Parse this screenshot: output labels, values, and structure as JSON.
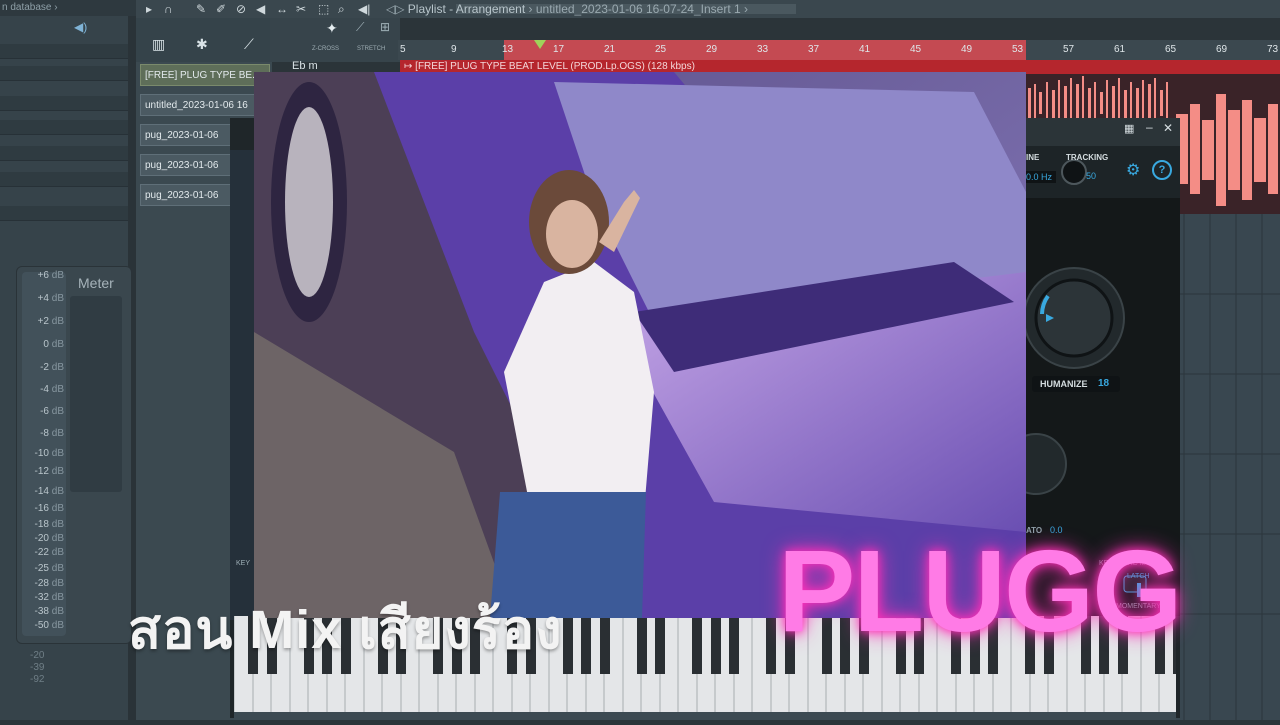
{
  "left_panel": {
    "breadcrumb": "n database",
    "meter": {
      "title": "Meter",
      "scale": [
        {
          "value": "+6",
          "unit": "dB"
        },
        {
          "value": "+4",
          "unit": "dB"
        },
        {
          "value": "+2",
          "unit": "dB"
        },
        {
          "value": "0",
          "unit": "dB"
        },
        {
          "value": "-2",
          "unit": "dB"
        },
        {
          "value": "-4",
          "unit": "dB"
        },
        {
          "value": "-6",
          "unit": "dB"
        },
        {
          "value": "-8",
          "unit": "dB"
        },
        {
          "value": "-10",
          "unit": "dB"
        },
        {
          "value": "-12",
          "unit": "dB"
        },
        {
          "value": "-14",
          "unit": "dB"
        },
        {
          "value": "-16",
          "unit": "dB"
        },
        {
          "value": "-18",
          "unit": "dB"
        },
        {
          "value": "-20",
          "unit": "dB"
        },
        {
          "value": "-22",
          "unit": "dB"
        },
        {
          "value": "-25",
          "unit": "dB"
        },
        {
          "value": "-28",
          "unit": "dB"
        },
        {
          "value": "-32",
          "unit": "dB"
        },
        {
          "value": "-38",
          "unit": "dB"
        },
        {
          "value": "-50",
          "unit": "dB"
        }
      ],
      "lower_scale": [
        "-20",
        "-39",
        "-92"
      ]
    }
  },
  "toolbar": {
    "playlist_title": "Playlist - Arrangement",
    "project_path": "untitled_2023-01-06 16-07-24_Insert 1"
  },
  "tool_strip": {
    "zcross_label": "Z-CROSS",
    "stretch_label": "STRETCH"
  },
  "ruler": {
    "bars": [
      "5",
      "9",
      "13",
      "17",
      "21",
      "25",
      "29",
      "33",
      "37",
      "41",
      "45",
      "49",
      "53",
      "57",
      "61",
      "65",
      "69",
      "73"
    ]
  },
  "tracks": [
    "[FREE] PLUG TYPE BE...",
    "untitled_2023-01-06 16",
    "pug_2023-01-06",
    "pug_2023-01-06",
    "pug_2023-01-06"
  ],
  "key_label": "Eb m",
  "clip_header": "[FREE] PLUG TYPE BEAT  LEVEL  (PROD.Lp.OGS) (128 kbps)",
  "plugin": {
    "line_label": "INE",
    "line_value": "0.0 Hz",
    "tracking_label": "TRACKING",
    "tracking_value": "50",
    "humanize_label": "HUMANIZE",
    "humanize_value": "18",
    "vibrato_label": "ATO",
    "vibrato_value": "0.0",
    "keyboard_mode_label": "KEYBOARD MODE",
    "latch_label": "LATCH",
    "momentary_label": "MOMENTARY",
    "left_label": "KEY"
  },
  "overlay": {
    "thai_title": "สอน Mix เสียงร้อง",
    "plugg": "PLUGG"
  },
  "colors": {
    "accent_pink": "#ff7be6",
    "loop_red": "#c44a52",
    "clip_red": "#b5262d",
    "knob_blue": "#39a9e0"
  }
}
